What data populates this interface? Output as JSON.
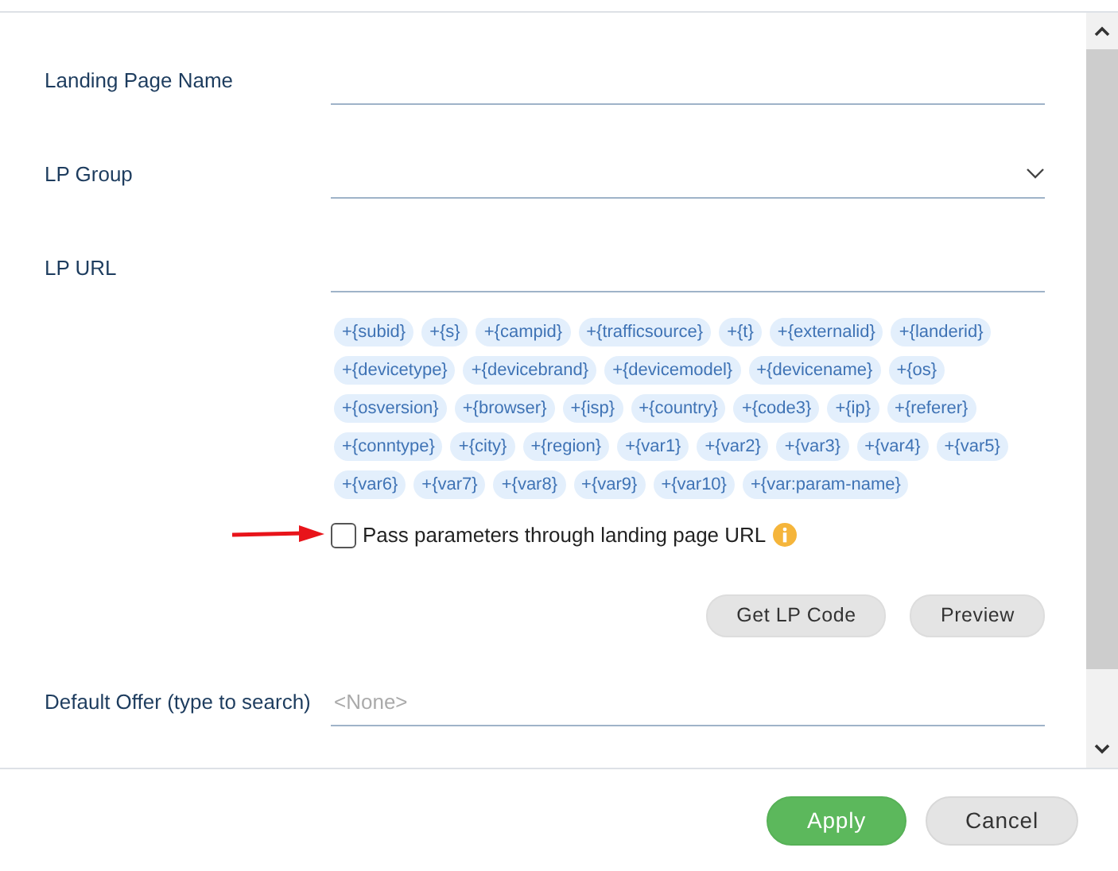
{
  "fields": [
    {
      "kind": "text",
      "label": "Landing Page Name"
    },
    {
      "kind": "select",
      "label": "LP Group"
    },
    {
      "kind": "text",
      "label": "LP URL"
    }
  ],
  "tokens": [
    "+{subid}",
    "+{s}",
    "+{campid}",
    "+{trafficsource}",
    "+{t}",
    "+{externalid}",
    "+{landerid}",
    "+{devicetype}",
    "+{devicebrand}",
    "+{devicemodel}",
    "+{devicename}",
    "+{os}",
    "+{osversion}",
    "+{browser}",
    "+{isp}",
    "+{country}",
    "+{code3}",
    "+{ip}",
    "+{referer}",
    "+{conntype}",
    "+{city}",
    "+{region}",
    "+{var1}",
    "+{var2}",
    "+{var3}",
    "+{var4}",
    "+{var5}",
    "+{var6}",
    "+{var7}",
    "+{var8}",
    "+{var9}",
    "+{var10}",
    "+{var:param-name}"
  ],
  "checkbox": {
    "label": "Pass parameters through landing page URL",
    "checked": false
  },
  "actions": [
    "Get LP Code",
    "Preview"
  ],
  "offer": {
    "label": "Default Offer (type to search)",
    "placeholder": "<None>"
  },
  "footer_buttons": [
    {
      "label": "Apply",
      "kind": "primary"
    },
    {
      "label": "Cancel",
      "kind": "secondary"
    }
  ]
}
